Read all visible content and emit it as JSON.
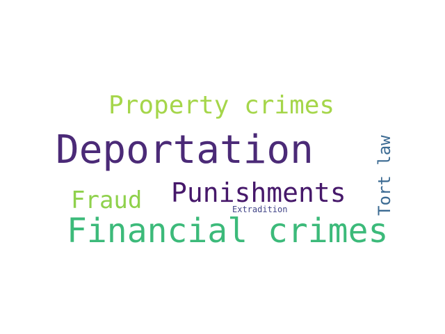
{
  "word_cloud": {
    "background": "#ffffff",
    "words": [
      {
        "text": "Property crimes",
        "color": "#a5d64a",
        "orientation": "horizontal"
      },
      {
        "text": "Deportation",
        "color": "#4b2a77",
        "orientation": "horizontal"
      },
      {
        "text": "Punishments",
        "color": "#46186a",
        "orientation": "horizontal"
      },
      {
        "text": "Fraud",
        "color": "#8fd14c",
        "orientation": "horizontal"
      },
      {
        "text": "Financial crimes",
        "color": "#3cba7a",
        "orientation": "horizontal"
      },
      {
        "text": "Extradition",
        "color": "#414487",
        "orientation": "horizontal"
      },
      {
        "text": "Tort law",
        "color": "#3b6a92",
        "orientation": "vertical"
      }
    ]
  }
}
